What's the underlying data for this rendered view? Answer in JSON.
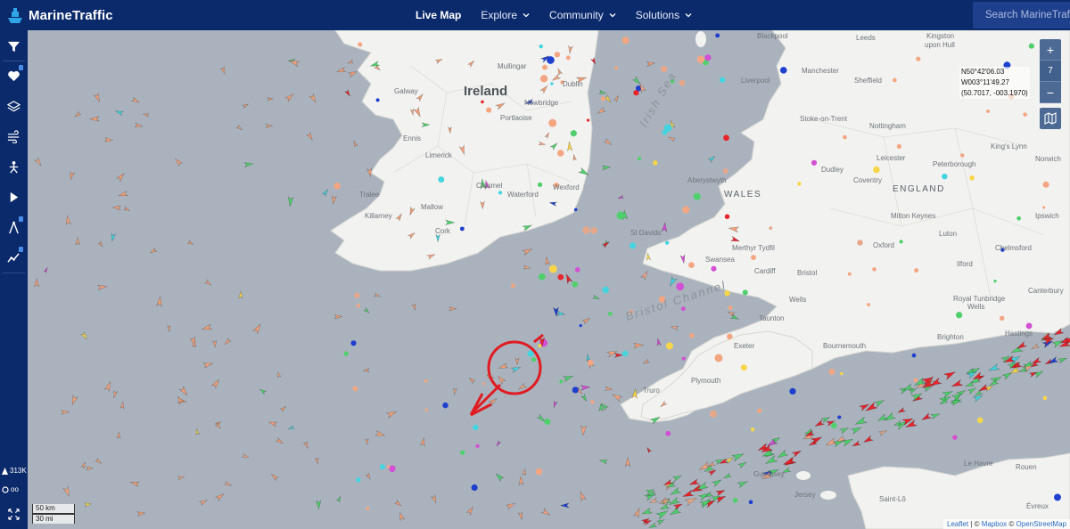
{
  "app": {
    "name": "MarineTraffic"
  },
  "nav": {
    "items": [
      {
        "label": "Live Map",
        "active": true,
        "dropdown": false
      },
      {
        "label": "Explore",
        "active": false,
        "dropdown": true
      },
      {
        "label": "Community",
        "active": false,
        "dropdown": true
      },
      {
        "label": "Solutions",
        "active": false,
        "dropdown": true
      }
    ],
    "search_placeholder": "Search MarineTraffic"
  },
  "sidebar": {
    "buttons": [
      "filter-icon",
      "heart-icon",
      "layers-icon",
      "wind-icon",
      "route-icon",
      "play-icon",
      "measure-icon",
      "chart-icon"
    ],
    "vessel_count": "313K",
    "speed_label": "oo"
  },
  "map": {
    "zoom_level": "7",
    "coordinates": {
      "line1": "N50°42'06.03",
      "line2": "W003°11'49.27",
      "line3": "(50.7017, -003.1970)"
    },
    "scale": {
      "metric": "50 km",
      "imperial": "30 mi"
    },
    "attribution": {
      "leaflet": "Leaflet",
      "sep1": " | © ",
      "mapbox": "Mapbox",
      "sep2": " © ",
      "osm": "OpenStreetMap"
    },
    "labels": {
      "ireland": "Ireland",
      "wales": "WALES",
      "england": "ENGLAND",
      "irish_sea": "Irish Sea",
      "bristol_channel": "Bristol Channel",
      "galway": "Galway",
      "ennis": "Ennis",
      "limerick": "Limerick",
      "tralee": "Tralee",
      "killarney": "Killarney",
      "mallow": "Mallow",
      "cork": "Cork",
      "clonmel": "Clonmel",
      "waterford": "Waterford",
      "wexford": "Wexford",
      "dublin": "Dublin",
      "newbridge": "Newbridge",
      "portlaoise": "Portlaoise",
      "mullingar": "Mullingar",
      "st_davids": "St Davids",
      "aberystwyth": "Aberystwyth",
      "merthyr": "Merthyr Tydfil",
      "swansea": "Swansea",
      "cardiff": "Cardiff",
      "bristol": "Bristol",
      "wells": "Wells",
      "taunton": "Taunton",
      "exeter": "Exeter",
      "plymouth": "Plymouth",
      "truro": "Truro",
      "bournemouth": "Bournemouth",
      "brighton": "Brighton",
      "hastings": "Hastings",
      "guernsey": "Guernsey",
      "jersey": "Jersey",
      "saint_lo": "Saint-Lô",
      "le_havre": "Le Havre",
      "rouen": "Rouen",
      "evreux": "Évreux",
      "leeds": "Leeds",
      "manchester": "Manchester",
      "sheffield": "Sheffield",
      "kingston": "Kingston",
      "upon_hull": "upon Hull",
      "liverpool": "Liverpool",
      "stoke": "Stoke-on-Trent",
      "nottingham": "Nottingham",
      "kings_lynn": "King's Lynn",
      "norwich": "Norwich",
      "dudley": "Dudley",
      "coventry": "Coventry",
      "leicester": "Leicester",
      "peterborough": "Peterborough",
      "milton_keynes": "Milton Keynes",
      "luton": "Luton",
      "oxford": "Oxford",
      "ipswich": "Ipswich",
      "chelmsford": "Chelmsford",
      "ilford": "Ilford",
      "royal_tunbridge": "Royal Tunbridge",
      "wells2": "Wells",
      "canterbury": "Canterbury",
      "blackpool": "Blackpool"
    }
  },
  "colors": {
    "brand": "#0b2a6b",
    "water": "#aab3bd",
    "land": "#f2f2f0",
    "annotation": "#e01b22"
  }
}
